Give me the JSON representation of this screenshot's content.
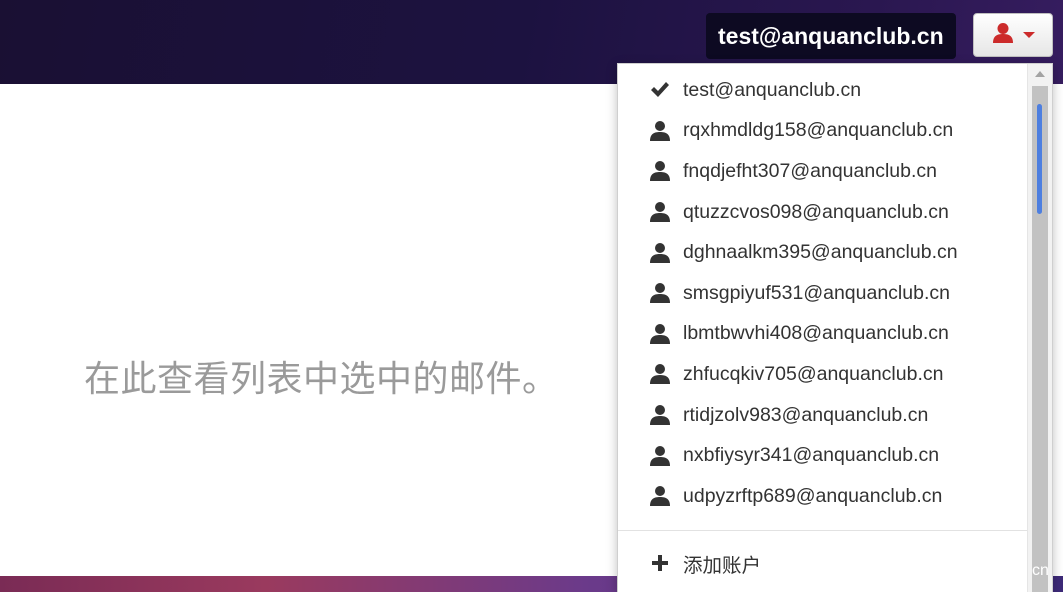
{
  "main": {
    "placeholder": "在此查看列表中选中的邮件。"
  },
  "header": {
    "current_account": "test@anquanclub.cn",
    "account_button_icon": "user-icon"
  },
  "dropdown": {
    "accounts": [
      {
        "email": "test@anquanclub.cn",
        "icon": "check-icon",
        "selected": true
      },
      {
        "email": "rqxhmdldg158@anquanclub.cn",
        "icon": "user-icon"
      },
      {
        "email": "fnqdjefht307@anquanclub.cn",
        "icon": "user-icon"
      },
      {
        "email": "qtuzzcvos098@anquanclub.cn",
        "icon": "user-icon"
      },
      {
        "email": "dghnaalkm395@anquanclub.cn",
        "icon": "user-icon"
      },
      {
        "email": "smsgpiyuf531@anquanclub.cn",
        "icon": "user-icon"
      },
      {
        "email": "lbmtbwvhi408@anquanclub.cn",
        "icon": "user-icon"
      },
      {
        "email": "zhfucqkiv705@anquanclub.cn",
        "icon": "user-icon"
      },
      {
        "email": "rtidjzolv983@anquanclub.cn",
        "icon": "user-icon"
      },
      {
        "email": "nxbfiysyr341@anquanclub.cn",
        "icon": "user-icon"
      },
      {
        "email": "udpyzrftp689@anquanclub.cn",
        "icon": "user-icon"
      }
    ],
    "add_account_label": "添加账户",
    "add_account_icon": "plus-icon"
  },
  "footer": {
    "corner_fragment": "cn"
  },
  "colors": {
    "user_icon_red": "#cc2b2b",
    "menu_icon": "#333333",
    "scroll_thumb": "#4d7fe0"
  }
}
